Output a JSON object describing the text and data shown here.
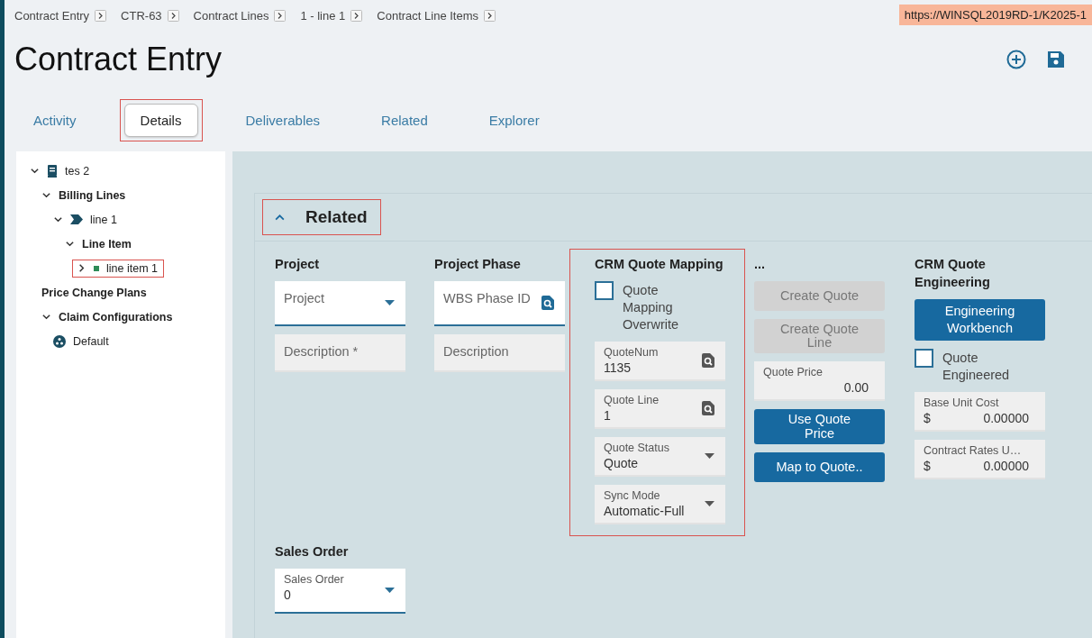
{
  "breadcrumbs": [
    "Contract Entry",
    "CTR-63",
    "Contract Lines",
    "1 - line 1",
    "Contract Line Items"
  ],
  "server_url": "https://WINSQL2019RD-1/K2025-1",
  "title": "Contract Entry",
  "tabs": [
    {
      "label": "Activity",
      "selected": false,
      "highlighted": false
    },
    {
      "label": "Details",
      "selected": true,
      "highlighted": true
    },
    {
      "label": "Deliverables",
      "selected": false,
      "highlighted": false
    },
    {
      "label": "Related",
      "selected": false,
      "highlighted": false
    },
    {
      "label": "Explorer",
      "selected": false,
      "highlighted": false
    }
  ],
  "tree": [
    {
      "label": "tes 2",
      "kind": "contract",
      "expandable": true,
      "expanded": true,
      "highlighted": false,
      "children": [
        {
          "label": "Billing Lines",
          "kind": "group",
          "expandable": true,
          "expanded": true,
          "highlighted": false,
          "children": [
            {
              "label": "line 1",
              "kind": "line",
              "expandable": true,
              "expanded": true,
              "highlighted": false,
              "children": [
                {
                  "label": "Line Item",
                  "kind": "group",
                  "expandable": true,
                  "expanded": true,
                  "highlighted": false,
                  "children": [
                    {
                      "label": "line item 1",
                      "kind": "item",
                      "expandable": true,
                      "expanded": false,
                      "highlighted": true
                    }
                  ]
                }
              ]
            }
          ]
        },
        {
          "label": "Price Change Plans",
          "kind": "group",
          "expandable": false,
          "expanded": false,
          "highlighted": false
        },
        {
          "label": "Claim Configurations",
          "kind": "group",
          "expandable": true,
          "expanded": true,
          "highlighted": false,
          "children": [
            {
              "label": "Default",
              "kind": "config",
              "expandable": false,
              "expanded": false,
              "highlighted": false
            }
          ]
        }
      ]
    }
  ],
  "related": {
    "title": "Related",
    "expanded": true,
    "highlighted": true,
    "sections": [
      {
        "heading": "Project",
        "highlighted": false,
        "items": [
          {
            "kind": "dropdown",
            "editable": true,
            "placeholder": "Project"
          },
          {
            "kind": "text",
            "editable": false,
            "placeholder": "Description *"
          }
        ]
      },
      {
        "heading": "Project Phase",
        "highlighted": false,
        "items": [
          {
            "kind": "lookup",
            "editable": true,
            "placeholder": "WBS Phase ID"
          },
          {
            "kind": "text",
            "editable": false,
            "placeholder": "Description"
          }
        ]
      },
      {
        "heading": "CRM Quote Mapping",
        "highlighted": true,
        "items": [
          {
            "kind": "checkbox",
            "label": "Quote Mapping Overwrite",
            "checked": false
          },
          {
            "kind": "lookup",
            "editable": false,
            "label": "QuoteNum",
            "value": "1135"
          },
          {
            "kind": "lookup",
            "editable": false,
            "label": "Quote Line",
            "value": "1"
          },
          {
            "kind": "dropdown",
            "editable": false,
            "label": "Quote Status",
            "value": "Quote"
          },
          {
            "kind": "dropdown",
            "editable": false,
            "label": "Sync Mode",
            "value": "Automatic-Full"
          }
        ]
      },
      {
        "heading": "...",
        "highlighted": false,
        "items": [
          {
            "kind": "button",
            "label": "Create Quote",
            "disabled": true
          },
          {
            "kind": "button",
            "label": "Create Quote Line",
            "disabled": true
          },
          {
            "kind": "number",
            "editable": false,
            "label": "Quote Price",
            "value": "0.00"
          },
          {
            "kind": "button",
            "label": "Use Quote Price",
            "disabled": false
          },
          {
            "kind": "button",
            "label": "Map to Quote..",
            "disabled": false
          }
        ]
      },
      {
        "heading": "CRM Quote Engineering",
        "highlighted": false,
        "items": [
          {
            "kind": "button",
            "label": "Engineering Workbench",
            "disabled": false
          },
          {
            "kind": "checkbox",
            "label": "Quote Engineered",
            "checked": false
          },
          {
            "kind": "currency",
            "editable": false,
            "label": "Base Unit Cost",
            "prefix": "$",
            "value": "0.00000"
          },
          {
            "kind": "currency",
            "editable": false,
            "label": "Contract Rates U…",
            "prefix": "$",
            "value": "0.00000"
          }
        ]
      },
      {
        "heading": "Sales Order",
        "highlighted": false,
        "items": [
          {
            "kind": "dropdown",
            "editable": true,
            "label": "Sales Order",
            "value": "0"
          }
        ]
      }
    ]
  }
}
